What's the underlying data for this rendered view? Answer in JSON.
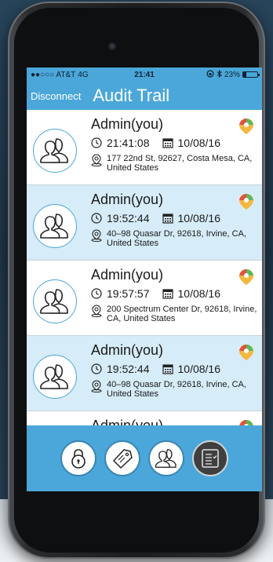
{
  "status_bar": {
    "carrier": "●●○○○ AT&T",
    "network": "4G",
    "time": "21:41",
    "battery": "23%",
    "battery_level": 0.23
  },
  "nav": {
    "back_label": "Disconnect",
    "title": "Audit Trail"
  },
  "entries": [
    {
      "name": "Admin(you)",
      "time": "21:41:08",
      "date": "10/08/16",
      "address": "177 22nd St, 92627, Costa Mesa, CA, United States"
    },
    {
      "name": "Admin(you)",
      "time": "19:52:44",
      "date": "10/08/16",
      "address": "40–98 Quasar Dr, 92618, Irvine, CA, United States"
    },
    {
      "name": "Admin(you)",
      "time": "19:57:57",
      "date": "10/08/16",
      "address": "200 Spectrum Center Dr, 92618, Irvine, CA, United States"
    },
    {
      "name": "Admin(you)",
      "time": "19:52:44",
      "date": "10/08/16",
      "address": "40–98 Quasar Dr, 92618, Irvine, CA, United States"
    },
    {
      "name": "Admin(you)"
    }
  ],
  "tabs": [
    {
      "icon": "lock-icon"
    },
    {
      "icon": "tag-icon"
    },
    {
      "icon": "users-icon"
    },
    {
      "icon": "audit-list-icon",
      "active": true
    }
  ],
  "colors": {
    "accent": "#4ba7d9",
    "row_alt": "#d6ecf8"
  }
}
